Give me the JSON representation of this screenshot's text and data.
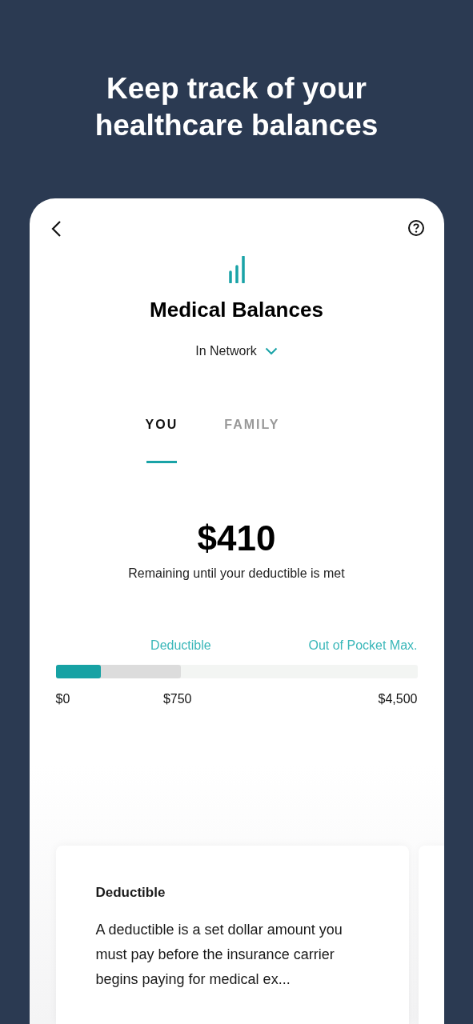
{
  "headline": "Keep track of your healthcare balances",
  "screen": {
    "title": "Medical Balances",
    "network_filter": {
      "label": "In Network"
    },
    "tabs": [
      {
        "label": "YOU",
        "selected": true
      },
      {
        "label": "FAMILY",
        "selected": false
      }
    ],
    "amount": "$410",
    "amount_caption": "Remaining until your deductible is met",
    "progress": {
      "level": 0.126,
      "deductible_label": "Deductible",
      "max_label": "Out of Pocket Max.",
      "deductible_segment": {
        "level": 0.346
      },
      "min_value": "$0",
      "deductible_value": "$750",
      "max_value": "$4,500"
    },
    "info_cards": [
      {
        "kind": "text",
        "title": "Deductible",
        "body": "A deductible is a set dollar amount you must pay before the insurance carrier begins paying for medical ex..."
      },
      {
        "kind": "peek"
      }
    ]
  }
}
